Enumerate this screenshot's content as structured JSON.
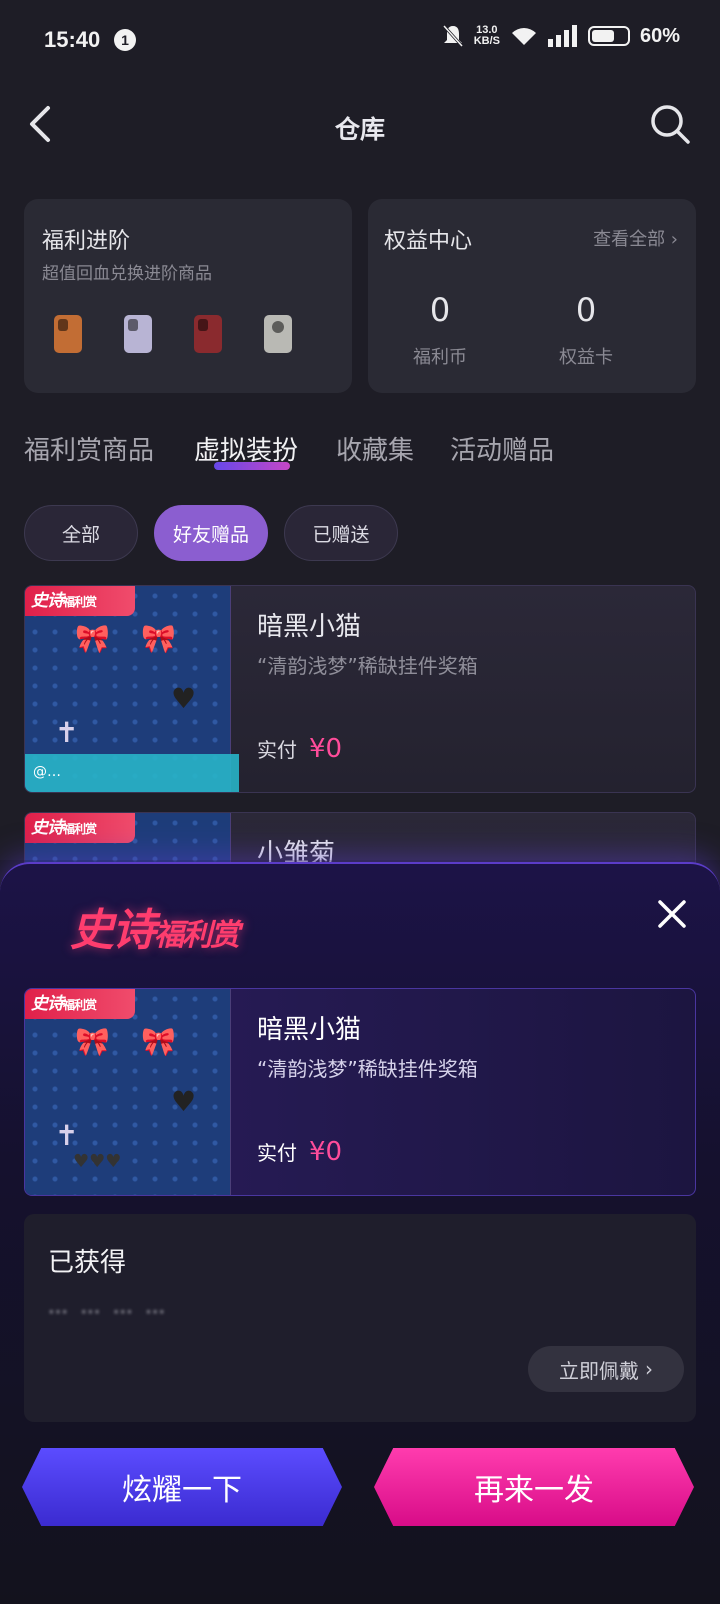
{
  "status": {
    "time": "15:40",
    "notif": "1",
    "net_speed": "13.0\nKB/S",
    "battery": "60%"
  },
  "nav": {
    "title": "仓库"
  },
  "welfare_card": {
    "title": "福利进阶",
    "subtitle": "超值回血兑换进阶商品",
    "phone_colors": [
      "#c26d34",
      "#b8b4d4",
      "#8a2a2e",
      "#b9b9b4"
    ]
  },
  "rights_card": {
    "title": "权益中心",
    "more": "查看全部 ›",
    "coins_value": "0",
    "coins_label": "福利币",
    "cards_value": "0",
    "cards_label": "权益卡"
  },
  "tabs": [
    "福利赏商品",
    "虚拟装扮",
    "收藏集",
    "活动赠品"
  ],
  "active_tab": "虚拟装扮",
  "chips": [
    "全部",
    "好友赠品",
    "已赠送"
  ],
  "active_chip": "好友赠品",
  "items": [
    {
      "badge_main": "史诗",
      "badge_sub": "福利赏",
      "name": "暗黑小猫",
      "desc": "“清韵浅梦”稀缺挂件奖箱",
      "price_label": "实付",
      "price": "¥0",
      "watermark": "@…"
    },
    {
      "badge_main": "史诗",
      "badge_sub": "福利赏",
      "name": "小雏菊"
    }
  ],
  "sheet": {
    "logo_main": "史诗",
    "logo_sub": "福利赏",
    "item": {
      "badge_main": "史诗",
      "badge_sub": "福利赏",
      "name": "暗黑小猫",
      "desc": "“清韵浅梦”稀缺挂件奖箱",
      "price_label": "实付",
      "price": "¥0"
    },
    "obtained_label": "已获得",
    "obtained_msg": "… … … …",
    "wear_button": "立即佩戴",
    "show_button": "炫耀一下",
    "again_button": "再来一发"
  },
  "colors": {
    "accent_purple": "#8b5ed0",
    "price_pink": "#ff4c9a",
    "badge_red": "#e0204a"
  }
}
